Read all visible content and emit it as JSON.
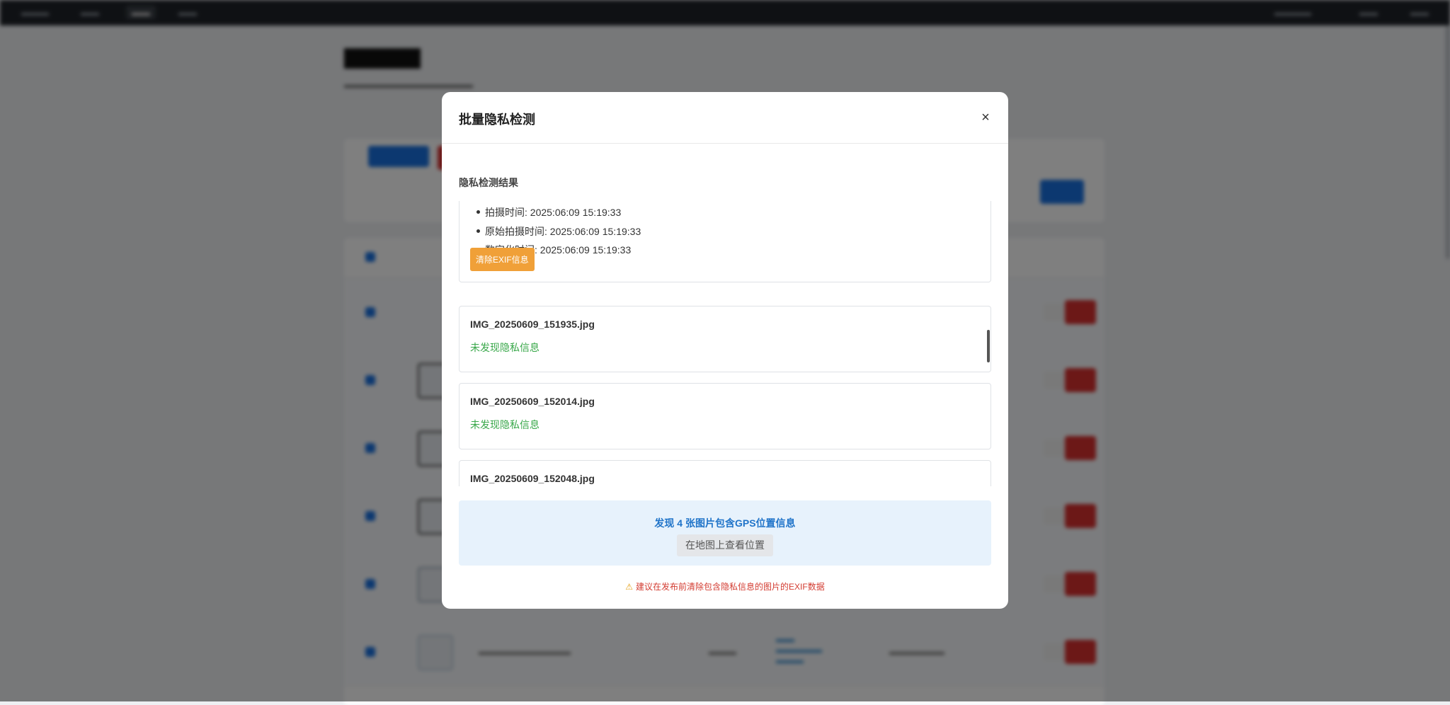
{
  "modal": {
    "title": "批量隐私检测",
    "close_label": "×",
    "section_title": "隐私检测结果",
    "cards": [
      {
        "details": [
          "拍摄时间: 2025:06:09 15:19:33",
          "原始拍摄时间: 2025:06:09 15:19:33",
          "数字化时间: 2025:06:09 15:19:33"
        ],
        "clear_button": "清除EXIF信息"
      },
      {
        "filename": "IMG_20250609_151935.jpg",
        "status": "未发现隐私信息"
      },
      {
        "filename": "IMG_20250609_152014.jpg",
        "status": "未发现隐私信息"
      },
      {
        "filename": "IMG_20250609_152048.jpg"
      }
    ],
    "gps_summary": "发现 4 张图片包含GPS位置信息",
    "map_button": "在地图上查看位置",
    "warning_icon": "⚠",
    "warning": "建议在发布前清除包含隐私信息的图片的EXIF数据"
  },
  "colors": {
    "status_ok": "#39a84a",
    "warning": "#d33b30",
    "gps_text": "#2074c9",
    "clear_button": "#f0a038"
  }
}
